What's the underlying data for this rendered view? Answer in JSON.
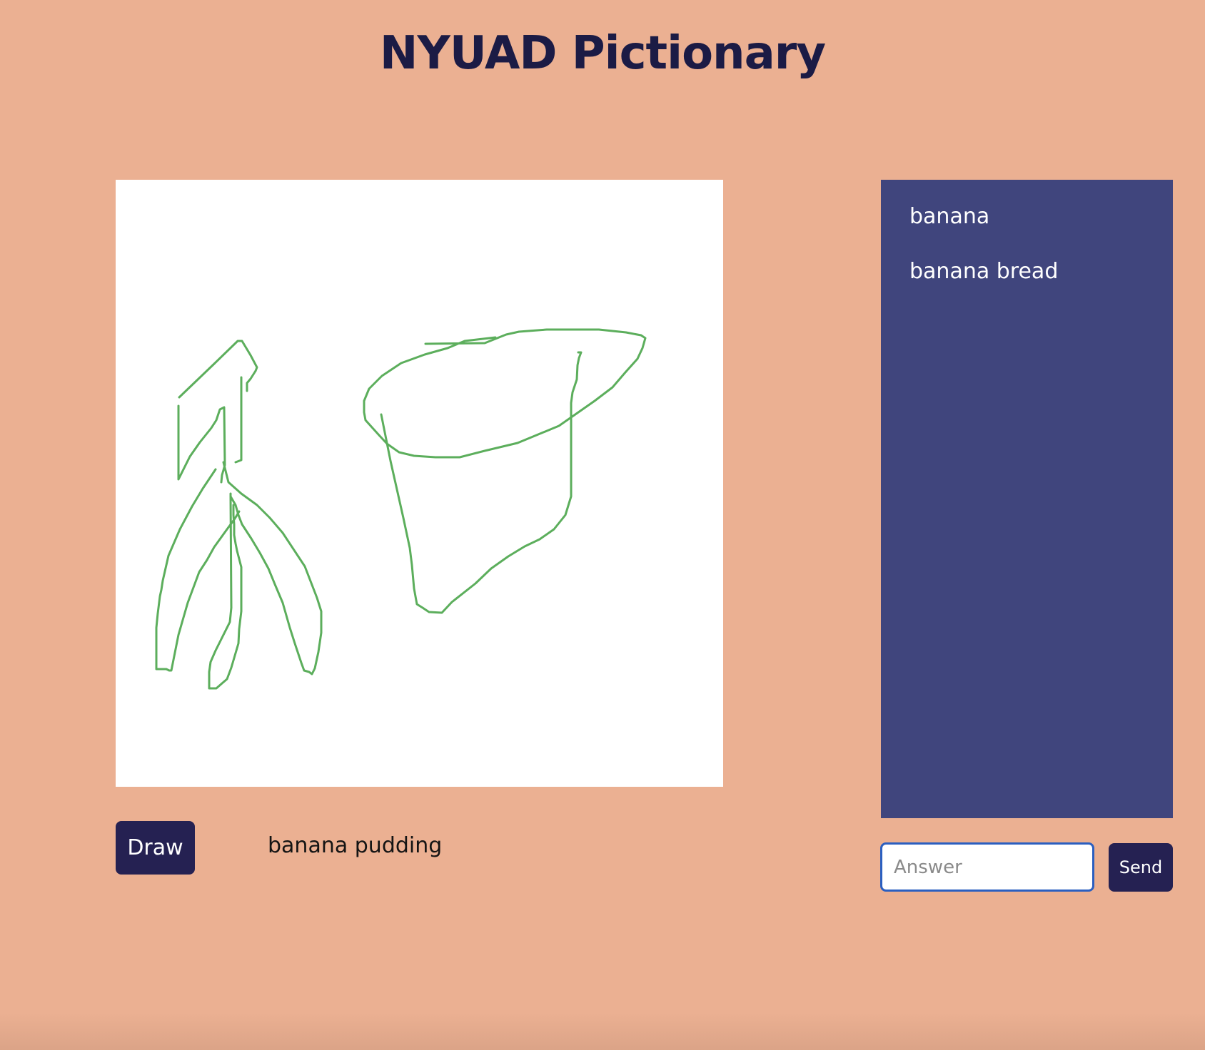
{
  "app": {
    "title": "NYUAD Pictionary"
  },
  "canvas": {
    "background": "#FFFFFF",
    "stroke_color": "#5CAE5C"
  },
  "controls": {
    "draw_label": "Draw",
    "current_word": "banana pudding"
  },
  "guesses": {
    "items": [
      {
        "text": "banana"
      },
      {
        "text": "banana bread"
      }
    ]
  },
  "answer": {
    "placeholder": "Answer",
    "value": "",
    "send_label": "Send"
  },
  "colors": {
    "page_background": "#EBB092",
    "title": "#1B1B45",
    "button": "#252152",
    "panel": "#40457D",
    "input_focus_border": "#2B5FC0"
  }
}
